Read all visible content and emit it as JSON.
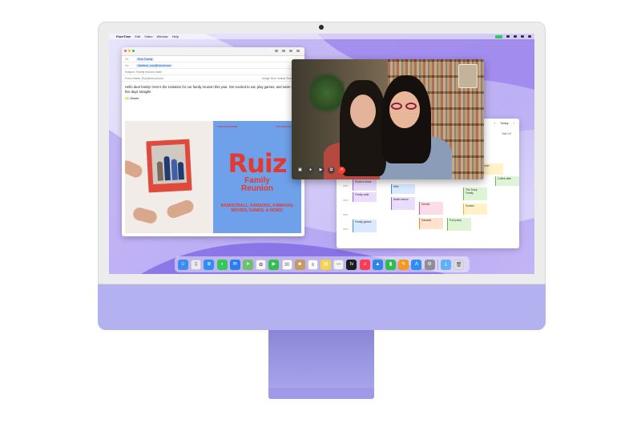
{
  "menubar": {
    "apple": "",
    "items": [
      "FaceTime",
      "Edit",
      "Video",
      "Window",
      "Help"
    ]
  },
  "mail": {
    "to_label": "To:",
    "to_value": "Ruiz Family",
    "cc_label": "Cc:",
    "cc_value": "Madison_ruiz@icloud.com",
    "subject_label": "Subject:",
    "subject_value": "Family reunion invite",
    "from_label": "From:",
    "from_value": "Gisele_Ruiz@icloud.com",
    "image_size": "Image Size: Actual Size",
    "body": "Hello dear family! Here's the invitation for our family reunion this year. Get excited to eat, play games, and swim for five days straight!",
    "signature": "🙌 Gisele"
  },
  "poster": {
    "top_left": "FIVE-DAYS-BASH",
    "top_right": "5TH AUGUST 2024",
    "name": "Ruiz",
    "sub_line1": "Family",
    "sub_line2": "Reunion",
    "activities": "BASKETBALL, KARAOKE, KAWAYAN, MOVIES, GAMES, & MORE!"
  },
  "calendar": {
    "today": "Today",
    "date": "Sat 24",
    "hours": [
      "1PM",
      "2PM",
      "3PM",
      "4PM",
      "5PM",
      "6PM"
    ],
    "events": [
      {
        "text": "Dinner",
        "color": "y"
      },
      {
        "text": "Coffee date",
        "color": "g"
      },
      {
        "text": "Photo a shoot",
        "color": "p"
      },
      {
        "text": "Family walk",
        "color": "p"
      },
      {
        "text": "The Tracy Family",
        "color": "g"
      },
      {
        "text": "Hike",
        "color": "b"
      },
      {
        "text": "Ballet lesson",
        "color": "p"
      },
      {
        "text": "Dentist",
        "color": "pk"
      },
      {
        "text": "Snacks",
        "color": "y"
      },
      {
        "text": "Pool party",
        "color": "g"
      },
      {
        "text": "Karaoke",
        "color": "o"
      },
      {
        "text": "Family games",
        "color": "b"
      }
    ]
  },
  "facetime": {
    "controls": [
      "sidebar",
      "mic",
      "video",
      "share",
      "end"
    ]
  },
  "dock": {
    "apps": [
      {
        "name": "finder-icon",
        "color": "#3d8bf0",
        "glyph": "☺"
      },
      {
        "name": "launchpad-icon",
        "color": "#e9e9ee",
        "glyph": "⠿"
      },
      {
        "name": "safari-icon",
        "color": "#2f8ef2",
        "glyph": "⊕"
      },
      {
        "name": "messages-icon",
        "color": "#34c759",
        "glyph": "◖"
      },
      {
        "name": "mail-icon",
        "color": "#2a7ff0",
        "glyph": "✉"
      },
      {
        "name": "maps-icon",
        "color": "#6cc26a",
        "glyph": "➤"
      },
      {
        "name": "photos-icon",
        "color": "#f6f6f6",
        "glyph": "✿"
      },
      {
        "name": "facetime-icon",
        "color": "#30c04e",
        "glyph": "▶"
      },
      {
        "name": "calendar-icon",
        "color": "#ffffff",
        "glyph": "30"
      },
      {
        "name": "contacts-icon",
        "color": "#c69a63",
        "glyph": "☻"
      },
      {
        "name": "reminders-icon",
        "color": "#fafafa",
        "glyph": "≡"
      },
      {
        "name": "notes-icon",
        "color": "#f8d34a",
        "glyph": "▤"
      },
      {
        "name": "freeform-icon",
        "color": "#f2f2f2",
        "glyph": "〰"
      },
      {
        "name": "tv-icon",
        "color": "#1c1c1e",
        "glyph": "tv"
      },
      {
        "name": "music-icon",
        "color": "#fa3c55",
        "glyph": "♫"
      },
      {
        "name": "keynote-icon",
        "color": "#2e86ea",
        "glyph": "▲"
      },
      {
        "name": "numbers-icon",
        "color": "#2ebd4f",
        "glyph": "▮"
      },
      {
        "name": "pages-icon",
        "color": "#f49a1c",
        "glyph": "✎"
      },
      {
        "name": "app-store-icon",
        "color": "#2f8ef2",
        "glyph": "A"
      },
      {
        "name": "settings-icon",
        "color": "#8e8e93",
        "glyph": "⚙"
      },
      {
        "name": "downloads-folder-icon",
        "color": "#5fb2f5",
        "glyph": "⤓"
      },
      {
        "name": "trash-icon",
        "color": "#d9dde3",
        "glyph": "🗑"
      }
    ]
  }
}
